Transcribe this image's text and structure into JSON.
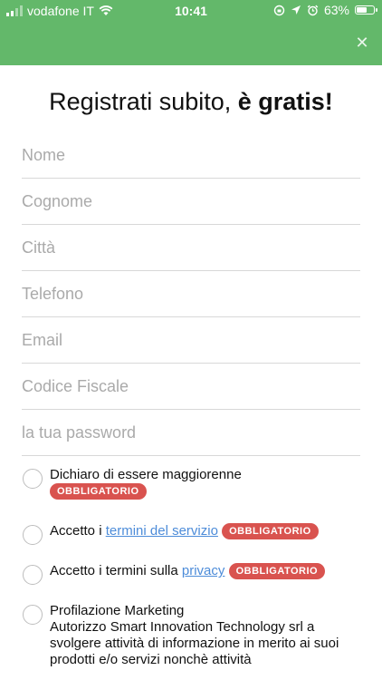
{
  "status": {
    "carrier": "vodafone IT",
    "time": "10:41",
    "battery_text": "63%",
    "battery_level": 0.63
  },
  "colors": {
    "header_green": "#63b86a",
    "badge_red": "#d9534f",
    "link_blue": "#4d8cd9"
  },
  "header": {
    "close_icon": "✕"
  },
  "title": {
    "part1": "Registrati subito, ",
    "part2": "è gratis!"
  },
  "fields": {
    "nome": "Nome",
    "cognome": "Cognome",
    "citta": "Città",
    "telefono": "Telefono",
    "email": "Email",
    "codice_fiscale": "Codice Fiscale",
    "password": "la tua password"
  },
  "checks": {
    "maggiorenne": {
      "label": "Dichiaro di essere maggiorenne",
      "badge": "OBBLIGATORIO"
    },
    "termini": {
      "prefix": "Accetto i ",
      "link": "termini del servizio",
      "badge": "OBBLIGATORIO"
    },
    "privacy": {
      "prefix": "Accetto i termini sulla ",
      "link": "privacy",
      "badge": "OBBLIGATORIO"
    },
    "marketing": {
      "label": "Profilazione Marketing",
      "desc": "Autorizzo Smart Innovation Technology srl a svolgere attività di informazione in merito ai suoi prodotti e/o servizi nonchè attività"
    }
  }
}
